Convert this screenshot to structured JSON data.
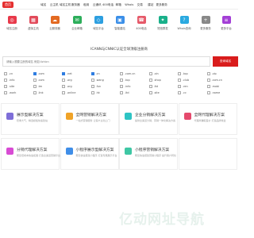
{
  "topnav": {
    "logo": "首页",
    "items": [
      "域名",
      "云主机",
      "域名主机",
      "服务器",
      "租用",
      "云通讯",
      "400电话",
      "邮箱",
      "Whois",
      "交易",
      "建站",
      "更多服务"
    ]
  },
  "icons": [
    {
      "label": "域名注册",
      "color": "#e8394a",
      "glyph": "◎"
    },
    {
      "label": "虚拟主机",
      "color": "#e24a5a",
      "glyph": "▦"
    },
    {
      "label": "云服务器",
      "color": "#e36a22",
      "glyph": "☁"
    },
    {
      "label": "企业邮箱",
      "color": "#2dae5b",
      "glyph": "✉"
    },
    {
      "label": "域名平台",
      "color": "#2d9fe0",
      "glyph": "◇"
    },
    {
      "label": "智能建站",
      "color": "#3b8fe8",
      "glyph": "▣"
    },
    {
      "label": "400电话",
      "color": "#e65a6a",
      "glyph": "☎"
    },
    {
      "label": "短信群发",
      "color": "#19b08a",
      "glyph": "✦"
    },
    {
      "label": "Whois查询",
      "color": "#2aa9e0",
      "glyph": "?"
    },
    {
      "label": "更多服务",
      "color": "#888888",
      "glyph": "+"
    },
    {
      "label": "更多平台",
      "color": "#a33fd6",
      "glyph": "≡"
    }
  ],
  "search": {
    "title": "ICANN与CNNIC认证全球顶级注册商",
    "placeholder": "请输入想要注册的域名 例如:lizhicn",
    "button": "查询域名"
  },
  "tlds": [
    ".cn",
    ".com",
    ".net",
    ".cn",
    ".com.cn",
    ".xin",
    ".top",
    ".vip",
    ".info",
    ".com",
    ".org",
    ".wang",
    ".top",
    ".shop",
    ".club",
    ".com.cn",
    ".site",
    ".tm",
    ".org",
    ".fun",
    ".info",
    ".ltd",
    ".ren",
    ".mobi",
    ".work",
    ".link",
    ".online",
    ".hk",
    ".ltd",
    ".site",
    ".cc",
    ".name"
  ],
  "tld_checked": [
    false,
    true,
    true,
    true,
    false,
    false,
    false,
    false,
    false,
    false,
    false,
    false,
    false,
    false,
    false,
    false,
    false,
    false,
    false,
    false,
    false,
    false,
    false,
    false,
    false,
    false,
    false,
    false,
    false,
    false,
    false,
    false
  ],
  "solutions": [
    {
      "title": "展示型解决方案",
      "desc": "稳重大气、精选模板快速建站",
      "color": "#7e6ed8"
    },
    {
      "title": "全网营销解决方案",
      "desc": "一站式营销服务 让客户主动上门",
      "color": "#f0a328"
    },
    {
      "title": "企业分销解决方案",
      "desc": "提供全渠道分销、营销一体化解决方案",
      "color": "#2ec4c4"
    },
    {
      "title": "全网代理解决方案",
      "desc": "代理商赚取差价 打造品牌收益",
      "color": "#e54a6d"
    },
    {
      "title": "分销代理解决方案",
      "desc": "帮您低成本快速拓展 打造全渠道营销平台",
      "color": "#d84bd4"
    },
    {
      "title": "小程序展示型解决方案",
      "desc": "帮您快速搭建小程序 打造专属展示平台",
      "color": "#3f8ee8"
    },
    {
      "title": "小程序营销解决方案",
      "desc": "帮您快速搭建营销小程序 提升客户转化",
      "color": "#3ec7a4"
    },
    {
      "title": "",
      "desc": "",
      "color": "#ffffff"
    }
  ],
  "watermark": "亿动网址导航"
}
